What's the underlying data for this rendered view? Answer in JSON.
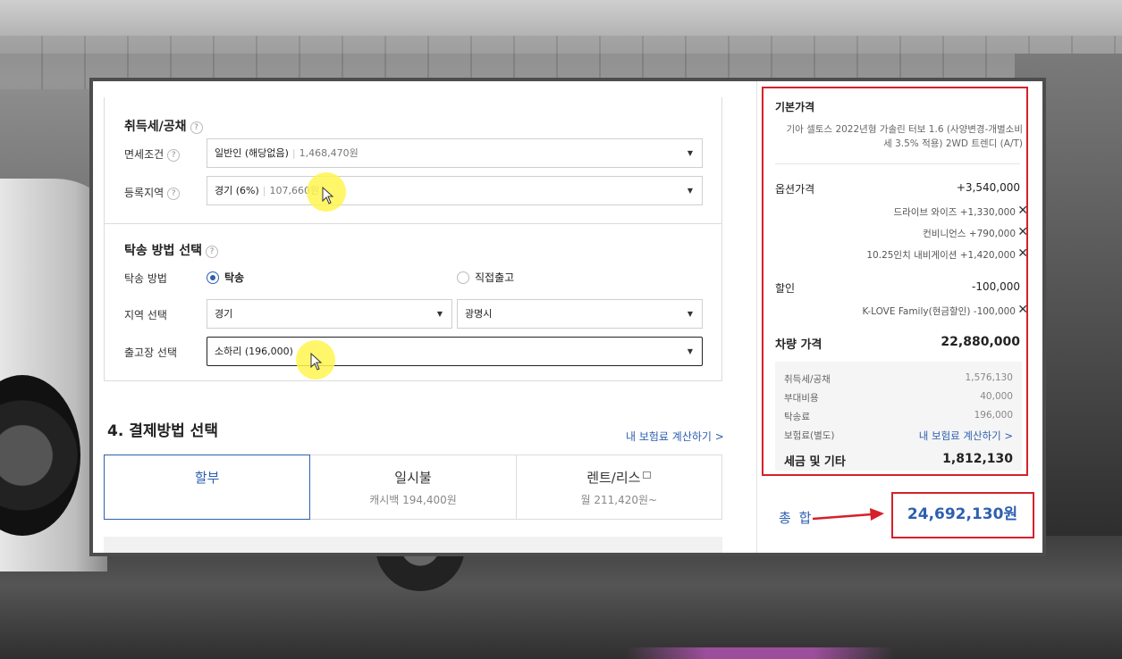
{
  "acquisition": {
    "title": "취득세/공채",
    "help": "?",
    "exemption_label": "면세조건",
    "exemption_value": "일반인 (해당없음)",
    "exemption_amount": "1,468,470원",
    "region_label": "등록지역",
    "region_value": "경기 (6%)",
    "region_amount": "107,660원"
  },
  "delivery": {
    "title": "탁송 방법 선택",
    "method_label": "탁송 방법",
    "opt_delivery": "탁송",
    "opt_pickup": "직접출고",
    "area_label": "지역 선택",
    "area_value": "경기",
    "city_value": "광명시",
    "factory_label": "출고장 선택",
    "factory_value": "소하리 (196,000)"
  },
  "payment": {
    "title": "4. 결제방법 선택",
    "insurance_link": "내 보험료 계산하기 >",
    "tabs": [
      {
        "label": "할부",
        "sub": ""
      },
      {
        "label": "일시불",
        "sub": "캐시백 194,400원"
      },
      {
        "label": "렌트/리스",
        "sub": "월 211,420원~"
      }
    ]
  },
  "summary": {
    "base_title": "기본가격",
    "base_desc": "기아 셀토스 2022년형 가솔린 터보 1.6 (사양변경-개별소비세 3.5% 적용) 2WD 트렌디 (A/T)",
    "option_label": "옵션가격",
    "option_value": "+3,540,000",
    "options": [
      {
        "name": "드라이브 와이즈",
        "price": "+1,330,000"
      },
      {
        "name": "컨비니언스",
        "price": "+790,000"
      },
      {
        "name": "10.25인치 내비게이션",
        "price": "+1,420,000"
      }
    ],
    "discount_label": "할인",
    "discount_value": "-100,000",
    "discount_item": {
      "name": "K-LOVE Family(현금할인)",
      "price": "-100,000"
    },
    "car_price_label": "차량 가격",
    "car_price_value": "22,880,000",
    "fees": [
      {
        "label": "취득세/공채",
        "value": "1,576,130"
      },
      {
        "label": "부대비용",
        "value": "40,000"
      },
      {
        "label": "탁송료",
        "value": "196,000"
      },
      {
        "label": "보험료(별도)",
        "value": "내 보험료 계산하기 >"
      }
    ],
    "tax_label": "세금 및 기타",
    "tax_value": "1,812,130",
    "total_label": "총 합",
    "total_value": "24,692,130원"
  },
  "icons": {
    "remove": "✕",
    "dropdown": "▼"
  },
  "colors": {
    "accent": "#2d5fb0",
    "highlight": "#d6202a"
  }
}
